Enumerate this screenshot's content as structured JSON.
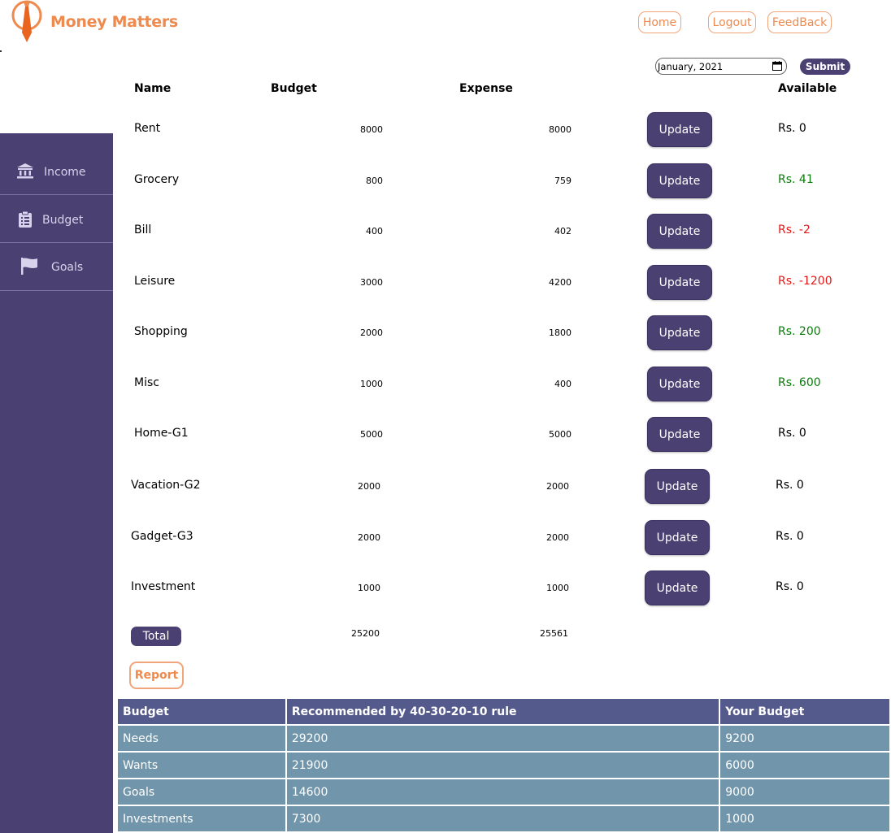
{
  "app": {
    "name": "Money Matters"
  },
  "nav": {
    "home": "Home",
    "logout": "Logout",
    "feedback": "FeedBack"
  },
  "sidebar": {
    "items": [
      {
        "label": "Income",
        "icon": "bank-icon"
      },
      {
        "label": "Budget",
        "icon": "clipboard-icon"
      },
      {
        "label": "Goals",
        "icon": "flag-icon"
      }
    ]
  },
  "filter": {
    "month": "January, 2021",
    "submit": "Submit"
  },
  "table": {
    "headers": {
      "name": "Name",
      "budget": "Budget",
      "expense": "Expense",
      "available": "Available"
    },
    "update_label": "Update",
    "rows": [
      {
        "name": "Rent",
        "budget": "8000",
        "expense": "8000",
        "available": "Rs. 0",
        "status": "zero"
      },
      {
        "name": "Grocery",
        "budget": "800",
        "expense": "759",
        "available": "Rs. 41",
        "status": "positive"
      },
      {
        "name": "Bill",
        "budget": "400",
        "expense": "402",
        "available": "Rs. -2",
        "status": "negative"
      },
      {
        "name": "Leisure",
        "budget": "3000",
        "expense": "4200",
        "available": "Rs. -1200",
        "status": "negative"
      },
      {
        "name": "Shopping",
        "budget": "2000",
        "expense": "1800",
        "available": "Rs. 200",
        "status": "positive"
      },
      {
        "name": "Misc",
        "budget": "1000",
        "expense": "400",
        "available": "Rs. 600",
        "status": "positive"
      },
      {
        "name": "Home-G1",
        "budget": "5000",
        "expense": "5000",
        "available": "Rs. 0",
        "status": "zero"
      },
      {
        "name": "Vacation-G2",
        "budget": "2000",
        "expense": "2000",
        "available": "Rs. 0",
        "status": "zero"
      },
      {
        "name": "Gadget-G3",
        "budget": "2000",
        "expense": "2000",
        "available": "Rs. 0",
        "status": "zero"
      },
      {
        "name": "Investment",
        "budget": "1000",
        "expense": "1000",
        "available": "Rs. 0",
        "status": "zero"
      }
    ],
    "total": {
      "label": "Total",
      "budget": "25200",
      "expense": "25561"
    }
  },
  "report": {
    "label": "Report"
  },
  "rule_table": {
    "headers": [
      "Budget",
      "Recommended by 40-30-20-10 rule",
      "Your Budget"
    ],
    "rows": [
      [
        "Needs",
        "29200",
        "9200"
      ],
      [
        "Wants",
        "21900",
        "6000"
      ],
      [
        "Goals",
        "14600",
        "9000"
      ],
      [
        "Investments",
        "7300",
        "1000"
      ]
    ]
  },
  "colors": {
    "accent": "#ef8a4e",
    "primary": "#4b4072",
    "positive": "#0a7a0a",
    "negative": "#e51616",
    "zero": "#000000",
    "table_header": "#555a8c",
    "table_cell": "#7195aa"
  }
}
